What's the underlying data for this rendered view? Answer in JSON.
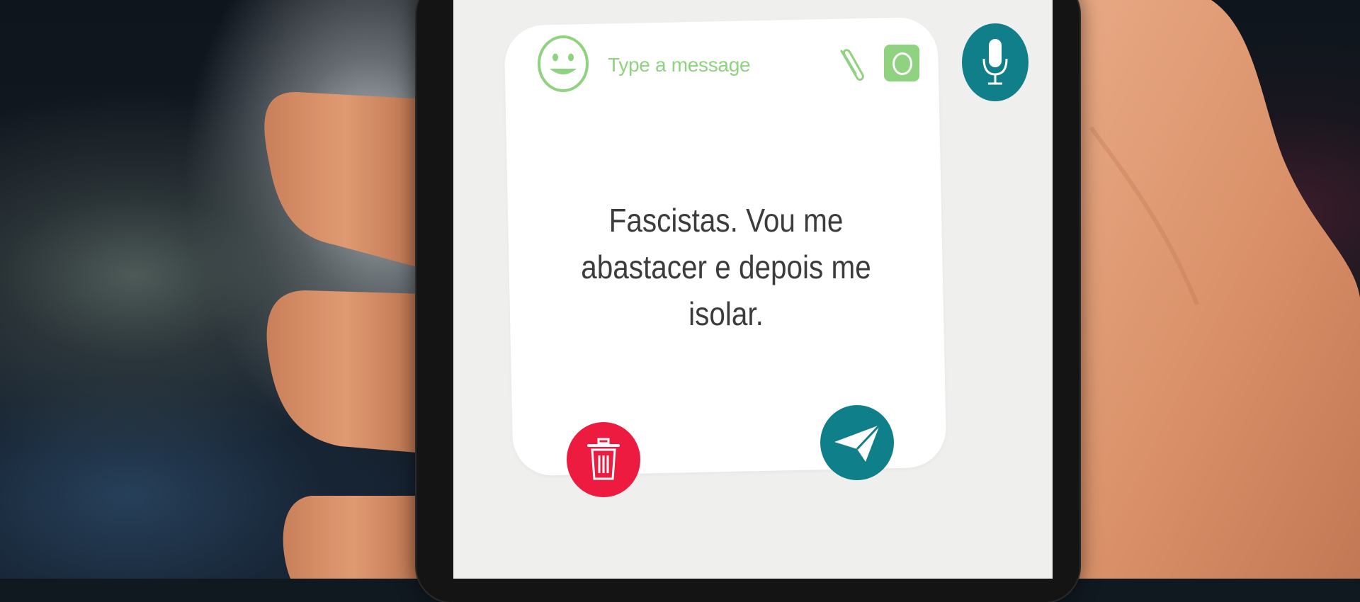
{
  "compose": {
    "placeholder": "Type a message",
    "message": "Fascistas. Vou me abastacer e depois me isolar."
  },
  "icons": {
    "emoji": "smiley-face-icon",
    "attach": "paperclip-icon",
    "camera": "camera-icon",
    "mic": "microphone-icon",
    "delete": "trash-icon",
    "send": "paper-plane-icon"
  },
  "colors": {
    "accent_green": "#8fd27f",
    "teal": "#117f8a",
    "delete_red": "#ec1b3f",
    "card": "#ffffff",
    "screen": "#efefee",
    "message_text": "#3c3c3c"
  }
}
